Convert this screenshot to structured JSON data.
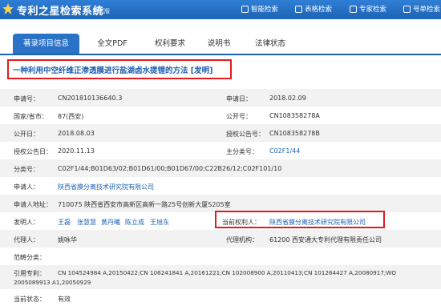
{
  "app": {
    "title": "专利之星检索系统",
    "subtitle": "测试版"
  },
  "nav": [
    {
      "label": "智能检索"
    },
    {
      "label": "表格检索"
    },
    {
      "label": "专家检索"
    },
    {
      "label": "号单检索"
    }
  ],
  "tabs": [
    {
      "label": "著录项目信息",
      "active": true
    },
    {
      "label": "全文PDF"
    },
    {
      "label": "权利要求"
    },
    {
      "label": "说明书"
    },
    {
      "label": "法律状态"
    }
  ],
  "patent": {
    "title": "一种利用中空纤维正渗透膜进行盐湖卤水提锂的方法 [发明]"
  },
  "fields": {
    "app_no_label": "申请号：",
    "app_no": "CN201810136640.3",
    "app_date_label": "申请日：",
    "app_date": "2018.02.09",
    "country_label": "国家/省市：",
    "country": "87(西安)",
    "pub_no_label": "公开号：",
    "pub_no": "CN108358278A",
    "pub_date_label": "公开日：",
    "pub_date": "2018.08.03",
    "grant_no_label": "授权公告号：",
    "grant_no": "CN108358278B",
    "grant_date_label": "授权公告日：",
    "grant_date": "2020.11.13",
    "main_class_label": "主分类号：",
    "main_class": "C02F1/44",
    "class_label": "分类号：",
    "class": "C02F1/44;B01D63/02;B01D61/00;B01D67/00;C22B26/12;C02F101/10",
    "applicant_label": "申请人：",
    "applicant": "陕西省膜分离技术研究院有限公司",
    "address_label": "申请人地址：",
    "address": "710075 陕西省西安市高新区高新一路25号创新大厦S205室",
    "inventors_label": "发明人：",
    "inventors": [
      "王磊",
      "张慧慧",
      "黄丹曦",
      "陈立成",
      "王旭东"
    ],
    "owner_label": "当前权利人：",
    "owner": "陕西省膜分离技术研究院有限公司",
    "agent_label": "代理人：",
    "agent": "姚咏华",
    "agency_label": "代理机构：",
    "agency": "61200 西安通大专利代理有限责任公司",
    "fan_label": "范畴分类：",
    "fan": "",
    "cited_label": "引用专利：",
    "cited_line1": "CN 104524984 A,20150422;CN 106241841 A,20161221;CN 102008900 A,20110413;CN 101264427 A,20080917;WO",
    "cited_line2": "2005089913 A1,20050929",
    "status_label": "当前状态：",
    "status": "有效"
  },
  "colors": {
    "header": "#1d63b5",
    "tab_active": "#2a72c6",
    "link": "#1d63b5",
    "highlight_box": "#e01c1c"
  }
}
